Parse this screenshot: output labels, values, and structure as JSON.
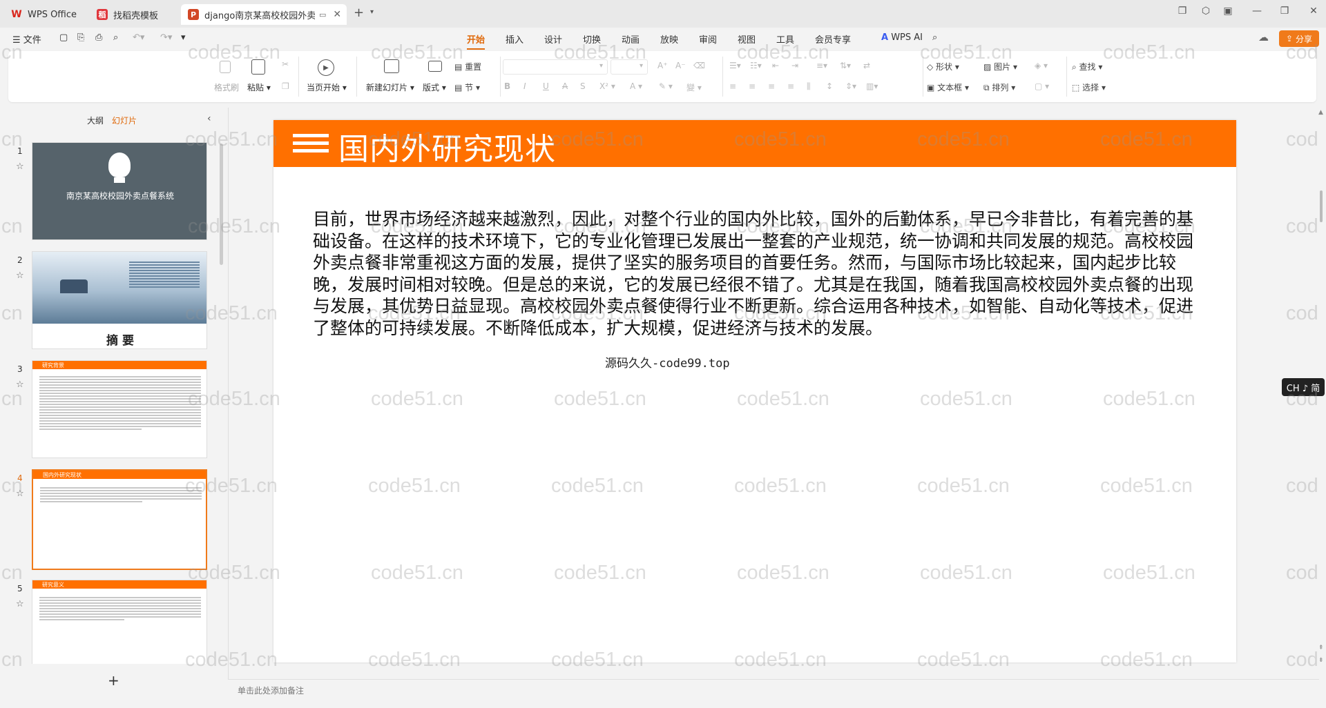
{
  "tabs": [
    {
      "label": "WPS Office",
      "icon": "wps-logo-icon",
      "color": "#d9261c"
    },
    {
      "label": "找稻壳模板",
      "icon": "docer-icon",
      "color": "#e0363c"
    },
    {
      "label": "django南京某高校校园外卖",
      "icon": "ppt-icon",
      "color": "#d24726"
    }
  ],
  "menu": {
    "file": "文件",
    "items": [
      "开始",
      "插入",
      "设计",
      "切换",
      "动画",
      "放映",
      "审阅",
      "视图",
      "工具",
      "会员专享"
    ],
    "active": "开始",
    "wps_ai": "WPS AI",
    "share": "分享"
  },
  "ribbon": {
    "format_painter": "格式刷",
    "paste": "粘贴",
    "play_from_current": "当页开始",
    "new_slide": "新建幻灯片",
    "layout": "版式",
    "reset": "重置",
    "section": "节",
    "shape": "形状",
    "picture": "图片",
    "textbox": "文本框",
    "arrange": "排列",
    "find": "查找",
    "select": "选择"
  },
  "left_panel": {
    "outline_tab": "大纲",
    "slides_tab": "幻灯片",
    "add_button": "+",
    "slides": [
      {
        "number": "1",
        "title": "南京某高校校园外卖点餐系统"
      },
      {
        "number": "2",
        "title": "摘 要"
      },
      {
        "number": "3",
        "title": "研究背景"
      },
      {
        "number": "4",
        "title": "国内外研究现状"
      },
      {
        "number": "5",
        "title": "研究意义"
      }
    ]
  },
  "slide": {
    "title": "国内外研究现状",
    "body": "目前，世界市场经济越来越激烈，因此，对整个行业的国内外比较，国外的后勤体系，早已今非昔比，有着完善的基础设备。在这样的技术环境下，它的专业化管理已发展出一整套的产业规范，统一协调和共同发展的规范。高校校园外卖点餐非常重视这方面的发展，提供了坚实的服务项目的首要任务。然而，与国际市场比较起来，国内起步比较晚，发展时间相对较晚。但是总的来说，它的发展已经很不错了。尤其是在我国，随着我国高校校园外卖点餐的出现与发展，其优势日益显现。高校校园外卖点餐使得行业不断更新。综合运用各种技术，如智能、自动化等技术，促进了整体的可持续发展。不断降低成本，扩大规模，促进经济与技术的发展。",
    "footer": "源码久久-code99.top",
    "header_color": "#ff7000"
  },
  "notes_placeholder": "单击此处添加备注",
  "ime_indicator": "CH ♪ 简",
  "watermark": "code51.cn",
  "watermark_short": "cn",
  "watermark_cut": "cod"
}
